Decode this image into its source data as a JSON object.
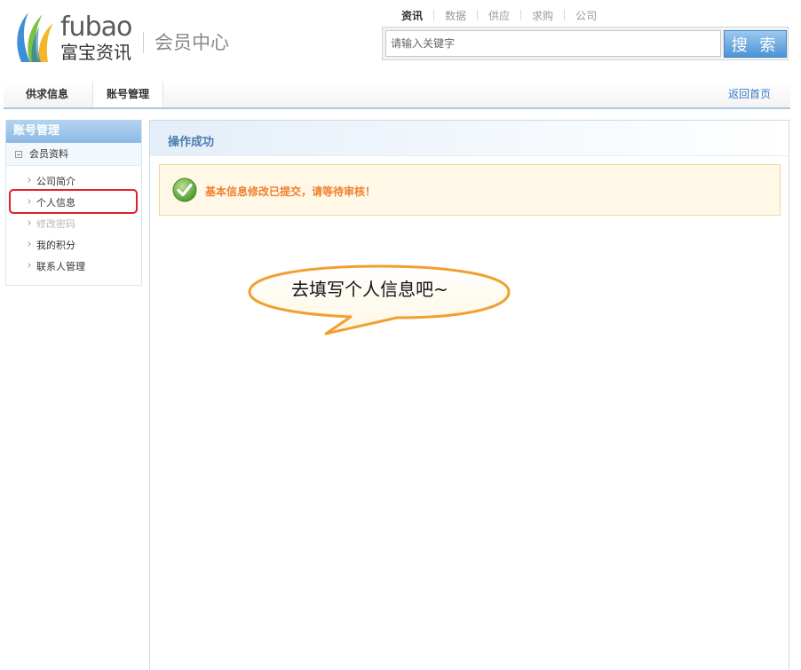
{
  "header": {
    "brand_en": "fubao",
    "brand_cn": "富宝资讯",
    "member_center": "会员中心",
    "top_nav": [
      {
        "label": "资讯",
        "active": true
      },
      {
        "label": "数据",
        "active": false
      },
      {
        "label": "供应",
        "active": false
      },
      {
        "label": "求购",
        "active": false
      },
      {
        "label": "公司",
        "active": false
      }
    ],
    "search": {
      "value": "",
      "placeholder": "请输入关键字",
      "button_label": "搜 索"
    }
  },
  "subnav": {
    "tabs": [
      {
        "label": "供求信息"
      },
      {
        "label": "账号管理"
      }
    ],
    "home_link": "返回首页"
  },
  "sidebar": {
    "title": "账号管理",
    "group": "会员资料",
    "items": [
      {
        "label": "公司简介",
        "enabled": true
      },
      {
        "label": "个人信息",
        "enabled": true
      },
      {
        "label": "修改密码",
        "enabled": false
      },
      {
        "label": "我的积分",
        "enabled": true
      },
      {
        "label": "联系人管理",
        "enabled": true
      }
    ]
  },
  "main": {
    "title": "操作成功",
    "message": "基本信息修改已提交，请等待审核！"
  },
  "callout": {
    "text": "去填写个人信息吧~"
  },
  "colors": {
    "accent_blue": "#4c93d4",
    "success_text": "#f07f31",
    "highlight_red": "#e0202a",
    "check_green": "#5aa63a"
  }
}
